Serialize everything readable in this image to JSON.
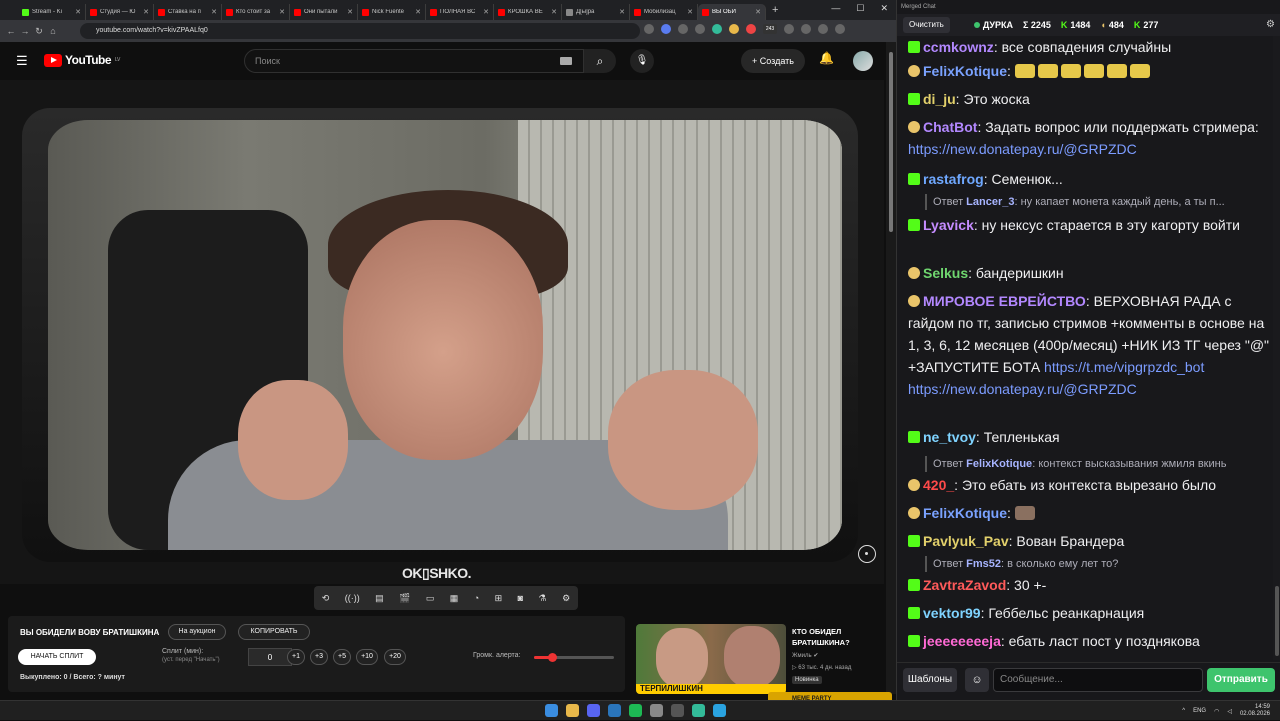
{
  "browser": {
    "tabs": [
      {
        "label": "Stream - Ki",
        "color": "#53fc18",
        "active": false
      },
      {
        "label": "Студия — Ю",
        "color": "#ff0000",
        "active": false
      },
      {
        "label": "Ставка на п",
        "color": "#ff0000",
        "active": false
      },
      {
        "label": "Кто стоит за",
        "color": "#ff0000",
        "active": false
      },
      {
        "label": "Они пытали",
        "color": "#ff0000",
        "active": false
      },
      {
        "label": "Nick Fuente",
        "color": "#ff0000",
        "active": false
      },
      {
        "label": "ПОЛНАЯ ВС",
        "color": "#ff0000",
        "active": false
      },
      {
        "label": "КРОШКА ВЕ",
        "color": "#ff0000",
        "active": false
      },
      {
        "label": "Д[ы]ра",
        "color": "#888888",
        "active": false
      },
      {
        "label": "Мобилизац",
        "color": "#ff0000",
        "active": false
      },
      {
        "label": "ВЫ ОБИ",
        "color": "#ff0000",
        "active": true
      }
    ],
    "url": "youtube.com/watch?v=kivZPAALfq0",
    "extension_badge": "243"
  },
  "youtube": {
    "logo_text": "YouTube",
    "logo_region": "LV",
    "search_placeholder": "Поиск",
    "create_label": "Создать",
    "video_watermark": "OK▯SHKO.",
    "panel": {
      "title": "ВЫ ОБИДЕЛИ ВОВУ БРАТИШКИНА",
      "auction_label": "На аукцион",
      "copy_label": "КОПИРОВАТЬ",
      "start_split_label": "НАЧАТЬ СПЛИТ",
      "split_label": "Сплит (мин):",
      "split_hint": "(уст. перед \"Начать\")",
      "split_value": "0",
      "increments": [
        "+1",
        "+3",
        "+5",
        "+10",
        "+20"
      ],
      "volume_label": "Громк. алерта:",
      "volume_level": 0.22,
      "bought_text": "Выкуплено: 0 / Всего: ? минут"
    },
    "recommendation": {
      "title": "КТО ОБИДЕЛ БРАТИШКИНА?",
      "channel": "Жмиль",
      "meta": "▷ 63 тыс.  4 дн. назад",
      "badge": "Новинка",
      "thumb_text": "ТЕРПИЛИШКИН",
      "overlay": "MEME PARTY"
    }
  },
  "chat": {
    "window_title": "Merged Chat",
    "clear_label": "Очистить",
    "channel": "ДУРКА",
    "totals": {
      "sum": "Σ 2245",
      "kick": "1484",
      "twitch": "484",
      "other": "277"
    },
    "messages": [
      {
        "platform": "kick",
        "user": "ccmkownz",
        "color": "#b388ff",
        "text": "все совпадения случайны"
      },
      {
        "platform": "twitch",
        "user": "FelixKotique",
        "color": "#7aa2ff",
        "text": "",
        "emotes": 6
      },
      {
        "platform": "kick",
        "user": "di_ju",
        "color": "#e2d06b",
        "text": "Это жоска"
      },
      {
        "platform": "twitch",
        "user": "ChatBot",
        "color": "#b388ff",
        "text": "Задать вопрос или поддержать стримера: ",
        "link": "https://new.donatepay.ru/@GRPZDC"
      },
      {
        "platform": "kick",
        "user": "rastafrog",
        "color": "#6fa8ff",
        "text": "Семенюк..."
      },
      {
        "platform": "reply",
        "user": "Lancer_3",
        "color": "#a7b4ff",
        "text": "ну капает монета каждый день, а ты п..."
      },
      {
        "platform": "kick",
        "user": "Lyavick",
        "color": "#c58cff",
        "text": "ну нексус старается в эту кагорту войти"
      },
      {
        "platform": "twitch",
        "user": "Selkus",
        "color": "#6fd66f",
        "text": "бандеришкин"
      },
      {
        "platform": "twitch",
        "user": "МИРОВОЕ ЕВРЕЙСТВО",
        "color": "#b388ff",
        "text": "ВЕРХОВНАЯ РАДА с гайдом по тг, записью стримов +комменты в основе на 1, 3, 6, 12 месяцев (400р/месяц) +НИК ИЗ ТГ через \"@\" +ЗАПУСТИТЕ БОТА",
        "link": "https://t.me/vipgrpzdc_bot",
        "link2": "https://new.donatepay.ru/@GRPZDC"
      },
      {
        "platform": "kick",
        "user": "ne_tvoy",
        "color": "#7fd3ff",
        "text": "Тепленькая"
      },
      {
        "platform": "reply",
        "user": "FelixKotique",
        "color": "#a7b4ff",
        "text": "контекст высказывания жмиля вкинь"
      },
      {
        "platform": "twitch",
        "user": "420_",
        "color": "#ff4a4a",
        "text": "Это ебать из контекста вырезано было"
      },
      {
        "platform": "twitch",
        "user": "FelixKotique",
        "color": "#7aa2ff",
        "text": ""
      },
      {
        "platform": "kick",
        "user": "Pavlyuk_Pav",
        "color": "#e2d06b",
        "text": "Вован Брандера"
      },
      {
        "platform": "reply",
        "user": "Fms52",
        "color": "#a7b4ff",
        "text": "в сколько ему лет то?"
      },
      {
        "platform": "kick",
        "user": "ZavtraZavod",
        "color": "#ff5a5a",
        "text": "30 +-"
      },
      {
        "platform": "kick",
        "user": "vektor99",
        "color": "#7fd3ff",
        "text": "Геббельс реанкарнация"
      },
      {
        "platform": "kick",
        "user": "jeeeeeeeeja",
        "color": "#ff6ad5",
        "text": "ебать ласт пост у позднякова"
      }
    ],
    "reply_prefix": "Ответ",
    "templates_label": "Шаблоны",
    "input_placeholder": "Сообщение...",
    "send_label": "Отправить"
  },
  "taskbar": {
    "lang": "ENG",
    "time": "14:59",
    "date": "02.08.2026"
  }
}
